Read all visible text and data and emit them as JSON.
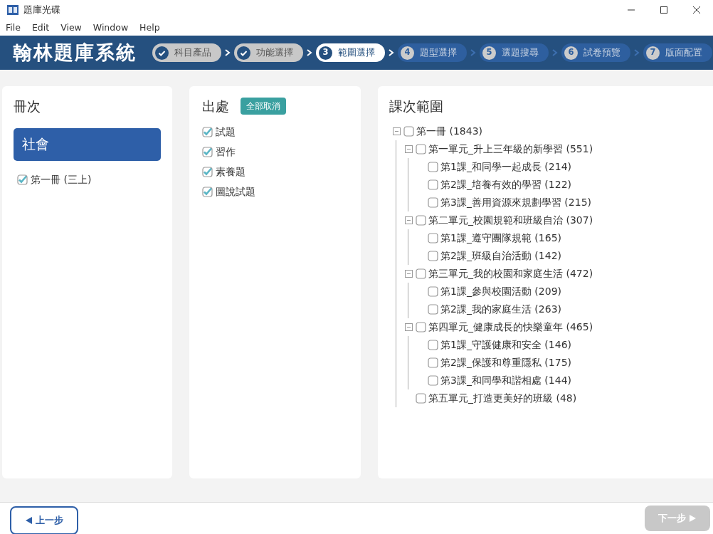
{
  "window": {
    "title": "題庫光碟"
  },
  "menu": [
    "File",
    "Edit",
    "View",
    "Window",
    "Help"
  ],
  "header": {
    "logo": "翰林題庫系統",
    "steps": [
      {
        "label": "科目產品",
        "completed": true,
        "selected": false
      },
      {
        "label": "功能選擇",
        "completed": true,
        "selected": false
      },
      {
        "number": "3",
        "label": "範圍選擇",
        "completed": false,
        "selected": true
      },
      {
        "number": "4",
        "label": "題型選擇",
        "completed": false,
        "selected": false
      },
      {
        "number": "5",
        "label": "選題搜尋",
        "completed": false,
        "selected": false
      },
      {
        "number": "6",
        "label": "試卷預覽",
        "completed": false,
        "selected": false
      },
      {
        "number": "7",
        "label": "版面配置",
        "completed": false,
        "selected": false
      }
    ]
  },
  "volume_panel": {
    "title": "冊次",
    "subject": {
      "label": "社會",
      "selected": true
    },
    "items": [
      {
        "label": "第一冊 (三上)",
        "checked": true
      }
    ]
  },
  "source_panel": {
    "title": "出處",
    "clear_button": "全部取消",
    "items": [
      {
        "label": "試題",
        "checked": true
      },
      {
        "label": "習作",
        "checked": true
      },
      {
        "label": "素養題",
        "checked": true
      },
      {
        "label": "圖說試題",
        "checked": true
      }
    ]
  },
  "range_panel": {
    "title": "課次範圍",
    "tree": [
      {
        "label": "第一冊 (1843)",
        "checked": false,
        "expanded": true,
        "children": [
          {
            "label": "第一單元_升上三年級的新學習 (551)",
            "checked": false,
            "expanded": true,
            "children": [
              {
                "label": "第1課_和同學一起成長 (214)",
                "checked": false
              },
              {
                "label": "第2課_培養有效的學習 (122)",
                "checked": false
              },
              {
                "label": "第3課_善用資源來規劃學習 (215)",
                "checked": false
              }
            ]
          },
          {
            "label": "第二單元_校園規範和班級自治 (307)",
            "checked": false,
            "expanded": true,
            "children": [
              {
                "label": "第1課_遵守團隊規範 (165)",
                "checked": false
              },
              {
                "label": "第2課_班級自治活動 (142)",
                "checked": false
              }
            ]
          },
          {
            "label": "第三單元_我的校園和家庭生活 (472)",
            "checked": false,
            "expanded": true,
            "children": [
              {
                "label": "第1課_參與校園活動 (209)",
                "checked": false
              },
              {
                "label": "第2課_我的家庭生活 (263)",
                "checked": false
              }
            ]
          },
          {
            "label": "第四單元_健康成長的快樂童年 (465)",
            "checked": false,
            "expanded": true,
            "children": [
              {
                "label": "第1課_守護健康和安全 (146)",
                "checked": false
              },
              {
                "label": "第2課_保護和尊重隱私 (175)",
                "checked": false
              },
              {
                "label": "第3課_和同學和諧相處 (144)",
                "checked": false
              }
            ]
          },
          {
            "label": "第五單元_打造更美好的班級 (48)",
            "checked": false
          }
        ]
      }
    ]
  },
  "footer": {
    "prev": {
      "label": "上一步",
      "disabled": false
    },
    "next": {
      "label": "下一步",
      "disabled": true
    }
  }
}
